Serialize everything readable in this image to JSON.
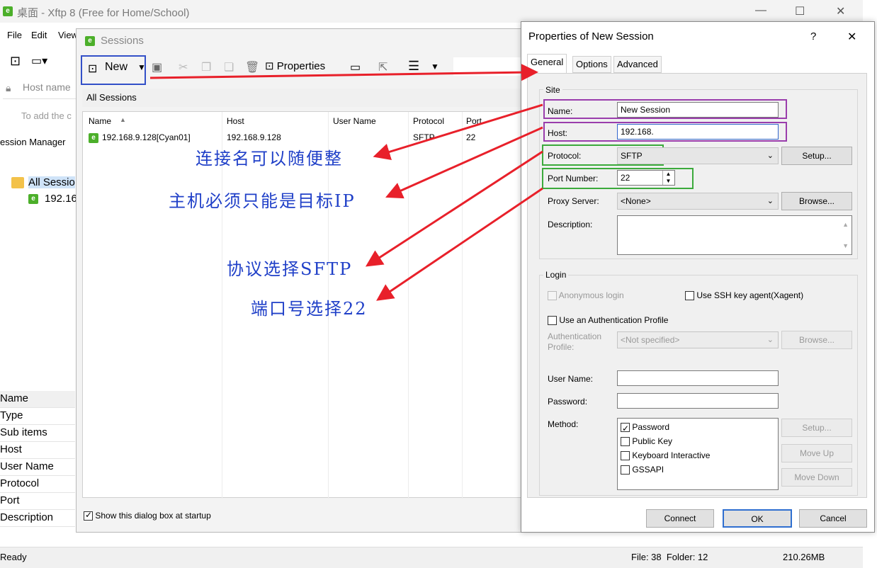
{
  "main": {
    "title": "桌面 - Xftp 8 (Free for Home/School)",
    "app_icon": "e",
    "menu": [
      "File",
      "Edit",
      "View"
    ],
    "host_placeholder": "Host name",
    "add_tip": "To add the c",
    "session_manager": "ession Manager",
    "tree_root": "All Sessio",
    "tree_child": "192.16",
    "properties": [
      "Name",
      "Type",
      "Sub items",
      "Host",
      "User Name",
      "Protocol",
      "Port",
      "Description"
    ],
    "status_left": "Ready",
    "status_files": "File: 38  Folder: 12",
    "status_size": "210.26MB"
  },
  "sessions": {
    "title": "Sessions",
    "new_label": "New",
    "properties_label": "Properties",
    "path": "All Sessions",
    "columns": [
      "Name",
      "Host",
      "User Name",
      "Protocol",
      "Port"
    ],
    "rows": [
      {
        "name": "192.168.9.128[Cyan01]",
        "host": "192.168.9.128",
        "user": "",
        "protocol": "SFTP",
        "port": "22"
      }
    ],
    "startup_label": "Show this dialog box at startup",
    "startup_checked": true
  },
  "props": {
    "title": "Properties of New Session",
    "help": "?",
    "close": "✕",
    "tabs": [
      "General",
      "Options",
      "Advanced"
    ],
    "site": {
      "title": "Site",
      "name_label": "Name:",
      "name_value": "New Session",
      "host_label": "Host:",
      "host_value": "192.168.",
      "protocol_label": "Protocol:",
      "protocol_value": "SFTP",
      "setup": "Setup...",
      "port_label": "Port Number:",
      "port_value": "22",
      "proxy_label": "Proxy Server:",
      "proxy_value": "<None>",
      "browse": "Browse...",
      "description_label": "Description:"
    },
    "login": {
      "title": "Login",
      "anonymous": "Anonymous login",
      "ssh_agent": "Use SSH key agent(Xagent)",
      "use_auth_profile": "Use an Authentication Profile",
      "auth_profile_label": "Authentication Profile:",
      "auth_profile_value": "<Not specified>",
      "browse": "Browse...",
      "user_label": "User Name:",
      "password_label": "Password:",
      "method_label": "Method:",
      "methods": [
        {
          "label": "Password",
          "checked": true
        },
        {
          "label": "Public Key",
          "checked": false
        },
        {
          "label": "Keyboard Interactive",
          "checked": false
        },
        {
          "label": "GSSAPI",
          "checked": false
        }
      ],
      "method_setup": "Setup...",
      "move_up": "Move Up",
      "move_down": "Move Down"
    },
    "connect": "Connect",
    "ok": "OK",
    "cancel": "Cancel"
  },
  "annotations": {
    "name_note": "连接名可以随便整",
    "host_note": "主机必须只能是目标IP",
    "protocol_note": "协议选择SFTP",
    "port_note": "端口号选择22"
  },
  "colors": {
    "highlight_purple": "#9a3dac",
    "highlight_green": "#3caa3c",
    "arrow_red": "#e8202a",
    "annotation_blue": "#2040c8",
    "new_box_blue": "#3350c8"
  }
}
